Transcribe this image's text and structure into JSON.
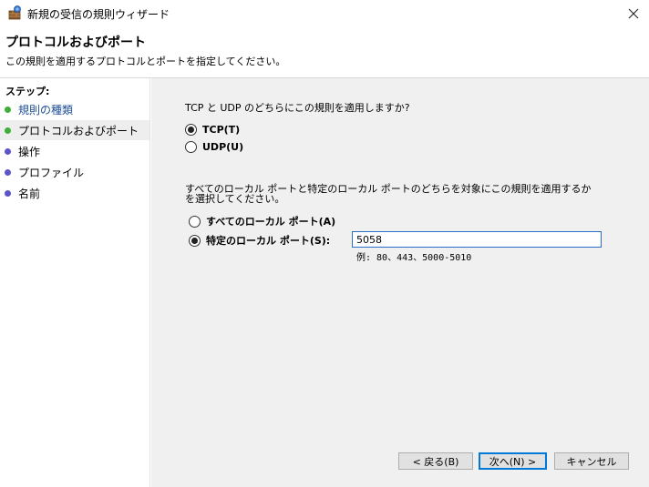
{
  "window": {
    "title": "新規の受信の規則ウィザード"
  },
  "header": {
    "title": "プロトコルおよびポート",
    "description": "この規則を適用するプロトコルとポートを指定してください。"
  },
  "sidebar": {
    "heading": "ステップ:",
    "steps": [
      {
        "label": "規則の種類",
        "status": "completed",
        "color": "#3fae3a"
      },
      {
        "label": "プロトコルおよびポート",
        "status": "current",
        "color": "#3fae3a"
      },
      {
        "label": "操作",
        "status": "pending",
        "color": "#5b55c9"
      },
      {
        "label": "プロファイル",
        "status": "pending",
        "color": "#5b55c9"
      },
      {
        "label": "名前",
        "status": "pending",
        "color": "#5b55c9"
      }
    ]
  },
  "protocol": {
    "question": "TCP と UDP のどちらにこの規則を適用しますか?",
    "tcp_label": "TCP(T)",
    "udp_label": "UDP(U)",
    "selected": "TCP"
  },
  "ports": {
    "question": "すべてのローカル ポートと特定のローカル ポートのどちらを対象にこの規則を適用するかを選択してください。",
    "all_label": "すべてのローカル ポート(A)",
    "specific_label": "特定のローカル ポート(S):",
    "selected": "specific",
    "value": "5058",
    "example": "例: 80、443、5000-5010"
  },
  "buttons": {
    "back": "< 戻る(B)",
    "next": "次へ(N) >",
    "cancel": "キャンセル"
  },
  "colors": {
    "accent": "#0078d7",
    "main_bg": "#f0f0f0",
    "link": "#1f4e99"
  }
}
